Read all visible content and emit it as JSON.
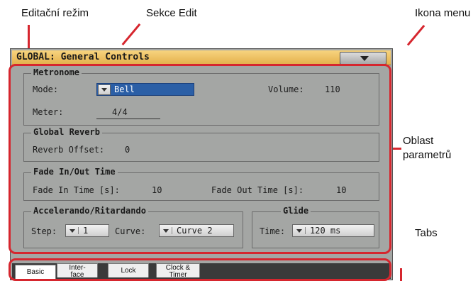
{
  "callouts": {
    "edit_mode": "Editační režim",
    "edit_section": "Sekce Edit",
    "menu_icon": "Ikona menu",
    "param_area_line1": "Oblast",
    "param_area_line2": "parametrů",
    "tabs": "Tabs"
  },
  "titlebar": {
    "mode": "GLOBAL:",
    "section": "General Controls"
  },
  "metronome": {
    "title": "Metronome",
    "mode_label": "Mode:",
    "mode_value": "Bell",
    "volume_label": "Volume:",
    "volume_value": "110",
    "meter_label": "Meter:",
    "meter_value": "4/4"
  },
  "reverb": {
    "title": "Global Reverb",
    "offset_label": "Reverb Offset:",
    "offset_value": "0"
  },
  "fade": {
    "title": "Fade In/Out Time",
    "in_label": "Fade In Time [s]:",
    "in_value": "10",
    "out_label": "Fade Out Time [s]:",
    "out_value": "10"
  },
  "accel": {
    "title": "Accelerando/Ritardando",
    "step_label": "Step:",
    "step_value": "1",
    "curve_label": "Curve:",
    "curve_value": "Curve 2"
  },
  "glide": {
    "title": "Glide",
    "time_label": "Time:",
    "time_value": "120 ms"
  },
  "tabs": [
    {
      "line1": "Basic",
      "line2": ""
    },
    {
      "line1": "Inter-",
      "line2": "face"
    },
    {
      "line1": "Lock",
      "line2": ""
    },
    {
      "line1": "Clock &",
      "line2": "Timer"
    }
  ],
  "colors": {
    "annotation": "#d6262e",
    "titlebar": "#f0c060",
    "panel": "#a4a6a4",
    "selected": "#2b5fa6"
  }
}
